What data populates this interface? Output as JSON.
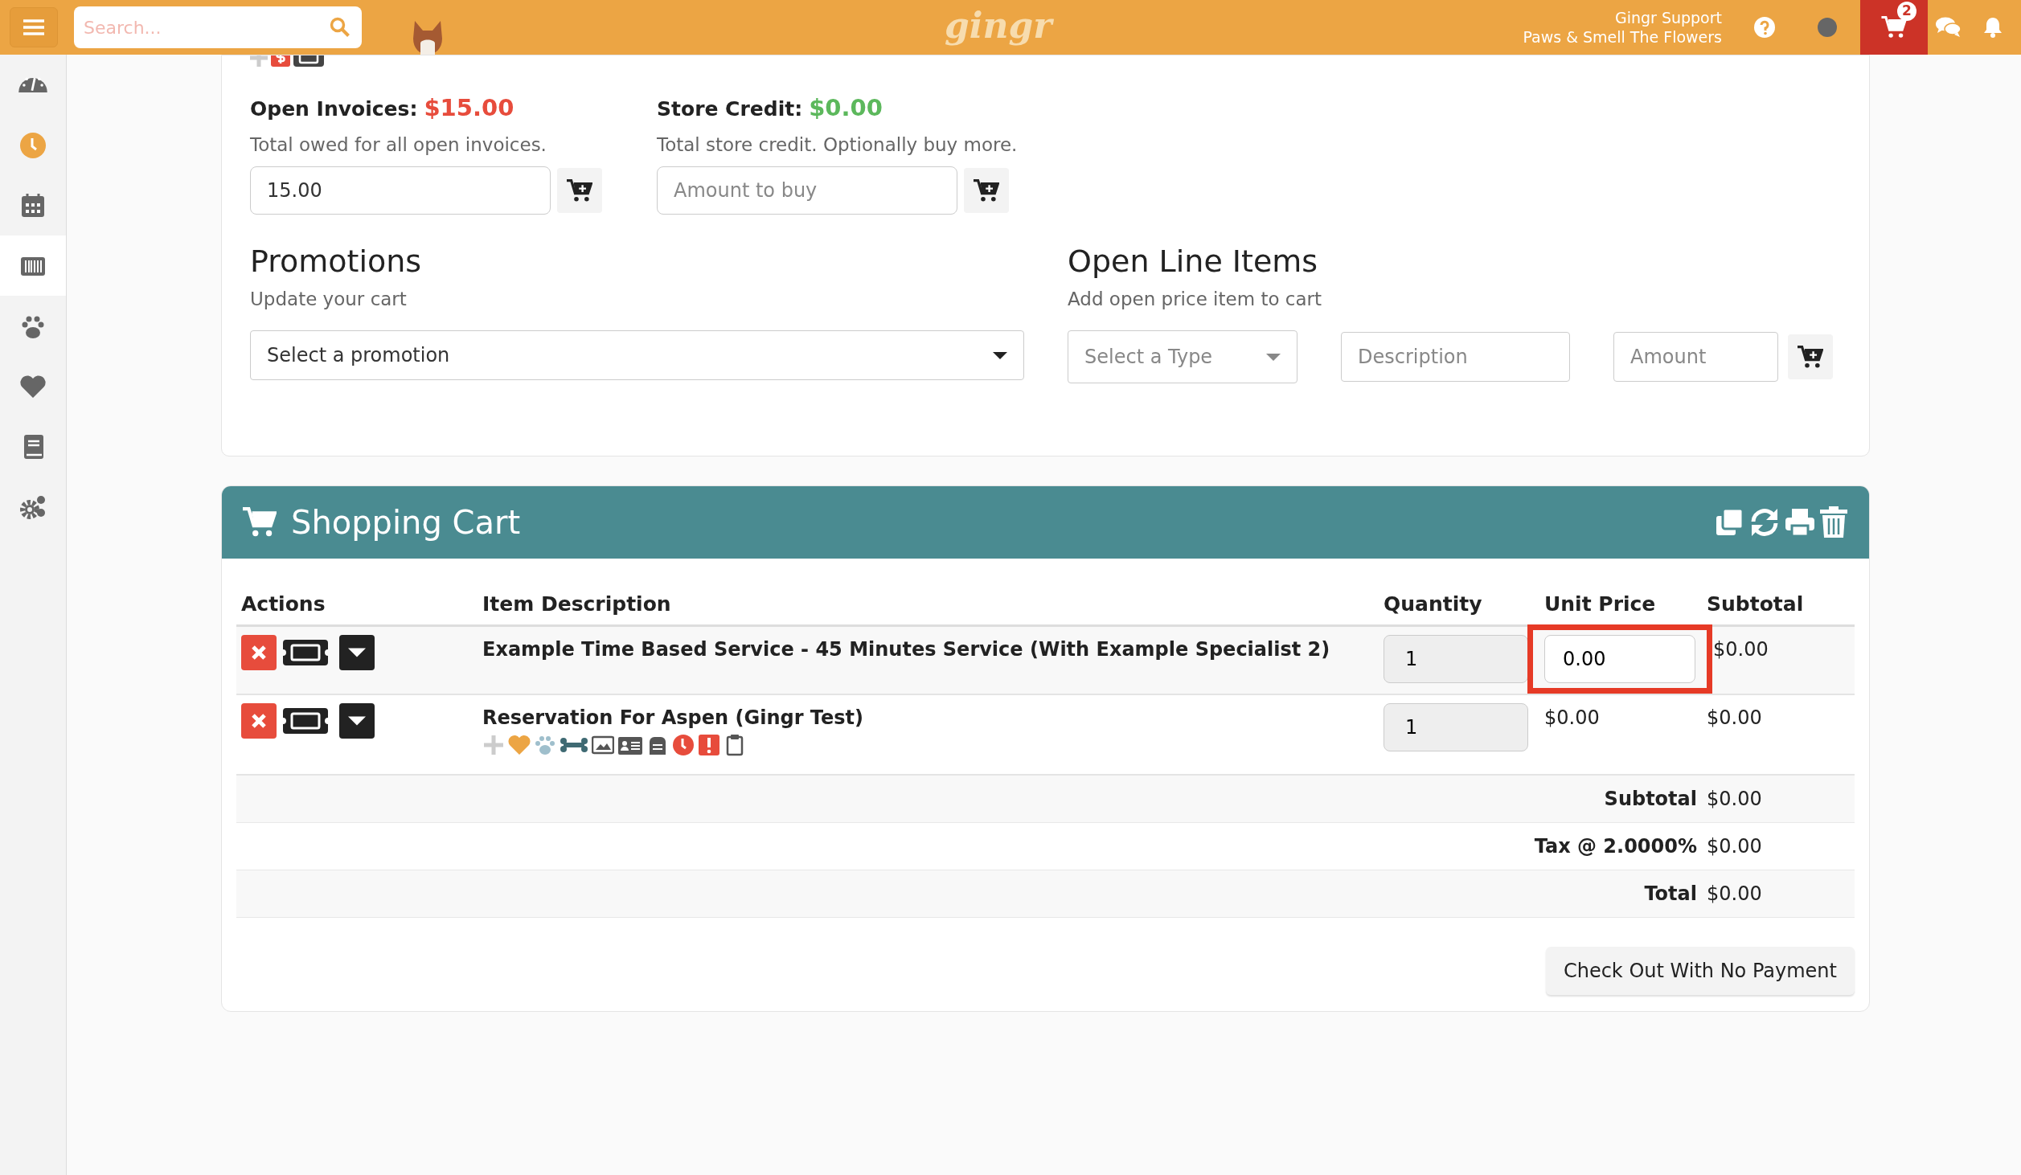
{
  "topbar": {
    "search": {
      "placeholder": "Search..."
    },
    "logo": "gingr",
    "user": {
      "name": "Gingr Support",
      "location": "Paws & Smell The Flowers"
    },
    "cart_count": "2"
  },
  "sidebar": {
    "items": [
      {
        "kind": "dashboard",
        "color": "#666666",
        "selected": false
      },
      {
        "kind": "clock",
        "color": "#eca544",
        "selected": false
      },
      {
        "kind": "calendar",
        "color": "#666666",
        "selected": false
      },
      {
        "kind": "barcode",
        "color": "#666666",
        "selected": true
      },
      {
        "kind": "paw",
        "color": "#666666",
        "selected": false
      },
      {
        "kind": "heart",
        "color": "#666666",
        "selected": false
      },
      {
        "kind": "book",
        "color": "#666666",
        "selected": false
      },
      {
        "kind": "gears",
        "color": "#666666",
        "selected": false
      }
    ]
  },
  "open_invoices": {
    "label": "Open Invoices:",
    "amount": "$15.00",
    "description": "Total owed for all open invoices.",
    "value": "15.00"
  },
  "store_credit": {
    "label": "Store Credit:",
    "amount": "$0.00",
    "description": "Total store credit. Optionally buy more.",
    "placeholder": "Amount to buy"
  },
  "promotions": {
    "title": "Promotions",
    "subtitle": "Update your cart",
    "select": "Select a promotion"
  },
  "open_line_items": {
    "title": "Open Line Items",
    "subtitle": "Add open price item to cart",
    "type_select": "Select a Type",
    "description_placeholder": "Description",
    "amount_placeholder": "Amount"
  },
  "cart": {
    "title": "Shopping Cart",
    "columns": [
      "Actions",
      "Item Description",
      "Quantity",
      "Unit Price",
      "Subtotal"
    ],
    "rows": [
      {
        "kind": "service",
        "description": "Example Time Based Service - 45 Minutes Service  (With Example Specialist 2)",
        "quantity": "1",
        "quantity_disabled": true,
        "unit_price": "0.00",
        "unit_price_editable": true,
        "highlighted": true,
        "subtotal": "$0.00"
      },
      {
        "kind": "reservation",
        "description": "Reservation For Aspen (Gingr Test)",
        "quantity": "1",
        "quantity_disabled": true,
        "unit_price": "$0.00",
        "unit_price_editable": false,
        "highlighted": false,
        "subtotal": "$0.00"
      }
    ],
    "totals": [
      {
        "label": "Subtotal",
        "value": "$0.00"
      },
      {
        "label": "Tax @ 2.0000%",
        "value": "$0.00"
      },
      {
        "label": "Total",
        "value": "$0.00"
      }
    ],
    "checkout_button": "Check Out With No Payment"
  }
}
